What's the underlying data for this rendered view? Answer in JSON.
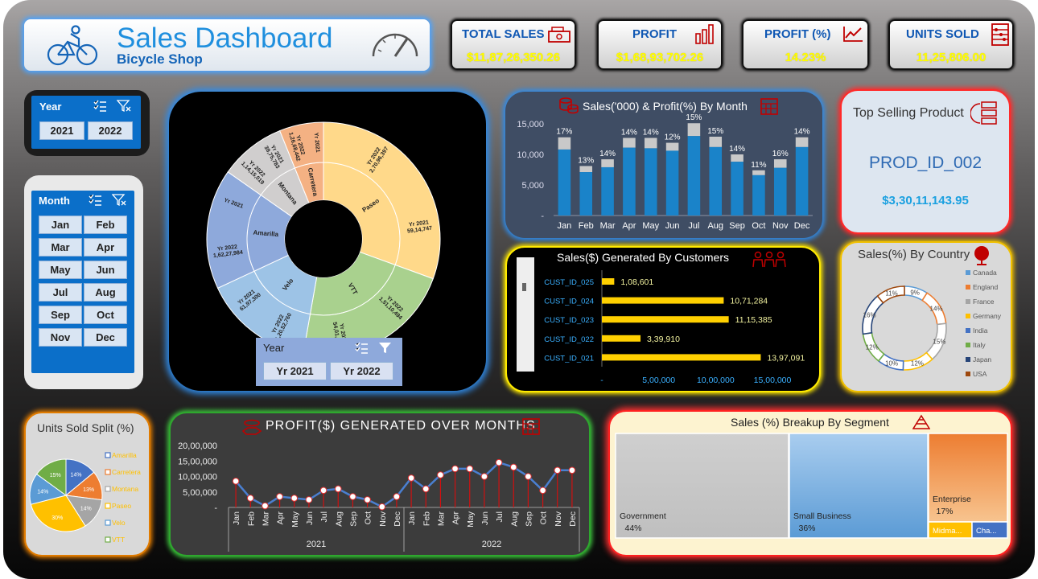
{
  "header": {
    "title": "Sales Dashboard",
    "subtitle": "Bicycle Shop"
  },
  "kpis": [
    {
      "label": "TOTAL SALES",
      "value": "$11,87,26,350.26",
      "icon": "cash-register-icon"
    },
    {
      "label": "PROFIT",
      "value": "$1,68,93,702.26",
      "icon": "bar-chart-icon"
    },
    {
      "label": "PROFIT (%)",
      "value": "14.23%",
      "icon": "trend-line-icon"
    },
    {
      "label": "UNITS SOLD",
      "value": "11,25,806.00",
      "icon": "abacus-icon"
    }
  ],
  "year_slicer": {
    "title": "Year",
    "items": [
      "2021",
      "2022"
    ]
  },
  "month_slicer": {
    "title": "Month",
    "items": [
      "Jan",
      "Feb",
      "Mar",
      "Apr",
      "May",
      "Jun",
      "Jul",
      "Aug",
      "Sep",
      "Oct",
      "Nov",
      "Dec"
    ]
  },
  "yr_slicer": {
    "title": "Year",
    "items": [
      "Yr 2021",
      "Yr 2022"
    ]
  },
  "top_product": {
    "title": "Top Selling Product",
    "product": "PROD_ID_002",
    "value": "$3,30,11,143.95"
  },
  "colors": {
    "accent_blue": "#1a83c9",
    "profit_gray": "#c9c9c9",
    "bar_yellow": "#ffd000",
    "kpi_value": "#ffff00"
  },
  "chart_data": [
    {
      "type": "sunburst",
      "title": "",
      "inner": [
        {
          "name": "Paseo",
          "labels": [
            {
              "text": "Yr 2022",
              "value": "2,70,96,397"
            },
            {
              "text": "Yr 2021",
              "value": "59,14,747"
            }
          ]
        },
        {
          "name": "VTT",
          "labels": [
            {
              "text": "Yr 2022",
              "value": "1,51,10,494"
            },
            {
              "text": "Yr 2021",
              "value": "54,01,457"
            }
          ]
        },
        {
          "name": "Velo",
          "labels": [
            {
              "text": "Yr 2022",
              "value": "1,20,52,760"
            },
            {
              "text": "Yr 2021",
              "value": "61,97,300"
            }
          ]
        },
        {
          "name": "Amarilla",
          "labels": [
            {
              "text": "Yr 2022",
              "value": "1,62,27,984"
            },
            {
              "text": "Yr 2021",
              "value": ""
            }
          ]
        },
        {
          "name": "Montana",
          "labels": [
            {
              "text": "Yr 2022",
              "value": "1,14,15,019"
            },
            {
              "text": "Yr 2021",
              "value": "39,75,783"
            }
          ]
        },
        {
          "name": "Carretera",
          "labels": [
            {
              "text": "Yr 2022",
              "value": "1,26,68,442"
            },
            {
              "text": "Yr 2021",
              "value": ""
            }
          ]
        }
      ]
    },
    {
      "type": "bar",
      "title": "Sales('000) & Profit(%) By Month",
      "categories": [
        "Jan",
        "Feb",
        "Mar",
        "Apr",
        "May",
        "Jun",
        "Jul",
        "Aug",
        "Sep",
        "Oct",
        "Nov",
        "Dec"
      ],
      "series": [
        {
          "values": [
            10800,
            7100,
            7900,
            11100,
            11000,
            10600,
            13000,
            11200,
            8800,
            6600,
            7800,
            11200
          ]
        },
        {
          "values": [
            12800,
            8100,
            9200,
            12700,
            12700,
            11900,
            15100,
            12900,
            10000,
            7400,
            9200,
            12800
          ]
        }
      ],
      "data_labels": [
        "17%",
        "13%",
        "14%",
        "14%",
        "14%",
        "12%",
        "15%",
        "15%",
        "14%",
        "11%",
        "16%",
        "14%"
      ],
      "yticks": [
        "-",
        "5,000",
        "10,000",
        "15,000"
      ],
      "ylim": [
        0,
        15000
      ]
    },
    {
      "type": "bar",
      "orientation": "horizontal",
      "title": "Sales($) Generated By Customers",
      "categories": [
        "CUST_ID_025",
        "CUST_ID_024",
        "CUST_ID_023",
        "CUST_ID_022",
        "CUST_ID_021"
      ],
      "values": [
        108601,
        1071284,
        1115385,
        339910,
        1397091
      ],
      "data_labels": [
        "1,08,601",
        "10,71,284",
        "11,15,385",
        "3,39,910",
        "13,97,091"
      ],
      "xticks": [
        "-",
        "5,00,000",
        "10,00,000",
        "15,00,000"
      ],
      "xlim": [
        0,
        1500000
      ]
    },
    {
      "type": "pie",
      "donut": true,
      "title": "Sales(%) By Country",
      "categories": [
        "Canada",
        "England",
        "France",
        "Germany",
        "India",
        "Italy",
        "Japan",
        "USA"
      ],
      "values": [
        9,
        14,
        15,
        12,
        10,
        12,
        16,
        11
      ],
      "colors": [
        "#5b9bd5",
        "#ed7d31",
        "#a5a5a5",
        "#ffc000",
        "#4472c4",
        "#70ad47",
        "#264478",
        "#9e480e"
      ],
      "legend": "right"
    },
    {
      "type": "pie",
      "title": "Units Sold Split (%)",
      "categories": [
        "Amarilla",
        "Carretera",
        "Montana",
        "Paseo",
        "Velo",
        "VTT"
      ],
      "values": [
        14,
        13,
        14,
        30,
        14,
        15
      ],
      "colors": [
        "#4472c4",
        "#ed7d31",
        "#a5a5a5",
        "#ffc000",
        "#5b9bd5",
        "#70ad47"
      ],
      "legend": "right"
    },
    {
      "type": "line",
      "title": "PROFIT($) GENERATED OVER MONTHS",
      "categories": [
        "Jan",
        "Feb",
        "Mar",
        "Apr",
        "May",
        "Jun",
        "Jul",
        "Aug",
        "Sep",
        "Oct",
        "Nov",
        "Dec",
        "Jan",
        "Feb",
        "Mar",
        "Apr",
        "May",
        "Jun",
        "Jul",
        "Aug",
        "Sep",
        "Oct",
        "Nov",
        "Dec"
      ],
      "groups": [
        "2021",
        "2022"
      ],
      "values": [
        850000,
        300000,
        50000,
        350000,
        300000,
        250000,
        550000,
        600000,
        350000,
        250000,
        20000,
        350000,
        950000,
        600000,
        1050000,
        1250000,
        1250000,
        1000000,
        1450000,
        1300000,
        1000000,
        550000,
        1200000,
        1200000
      ],
      "yticks": [
        "-",
        "5,00,000",
        "10,00,000",
        "15,00,000",
        "20,00,000"
      ],
      "ylim": [
        0,
        2000000
      ]
    },
    {
      "type": "treemap",
      "title": "Sales (%) Breakup By Segment",
      "categories": [
        "Government",
        "Small Business",
        "Enterprise",
        "Midma...",
        "Cha..."
      ],
      "values": [
        44,
        36,
        17,
        2,
        1
      ],
      "data_labels": [
        "44%",
        "36%",
        "17%",
        "",
        ""
      ]
    }
  ]
}
